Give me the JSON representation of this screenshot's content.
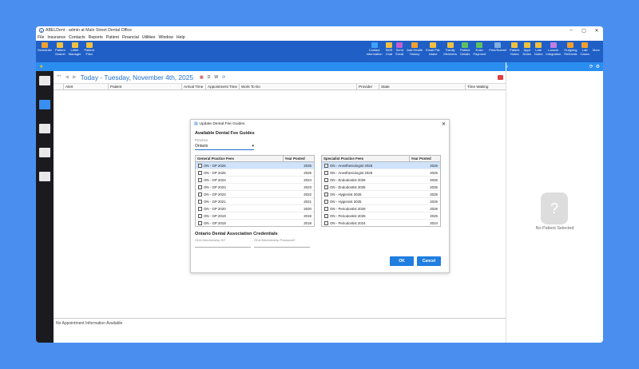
{
  "window": {
    "title": "ABELDent - admin at Main Street Dental Office"
  },
  "menu": [
    "File",
    "Insurance",
    "Contacts",
    "Reports",
    "Patient",
    "Financial",
    "Utilities",
    "Window",
    "Help"
  ],
  "toolbar_left": [
    {
      "label": "Scheduler",
      "icon": "scheduler-icon",
      "color": "#f0a030"
    },
    {
      "label": "Patient\nSearch",
      "icon": "patient-search-icon",
      "color": "#f0c040"
    },
    {
      "label": "Letter\nManager",
      "icon": "letter-manager-icon",
      "color": "#f0c040"
    },
    {
      "label": "Patient\nFiles",
      "icon": "patient-files-icon",
      "color": "#f0c040"
    }
  ],
  "toolbar_right": [
    {
      "label": "Contact\nInformation",
      "icon": "contact-info-icon",
      "color": "#3fa0ff"
    },
    {
      "label": "SMS\nChat",
      "icon": "sms-chat-icon",
      "color": "#f0c040"
    },
    {
      "label": "Send\nEmail",
      "icon": "send-email-icon",
      "color": "#c060d0"
    },
    {
      "label": "Add Health\nHistory",
      "icon": "health-history-icon",
      "color": "#f0a030"
    },
    {
      "label": "Email Pat.\nIntake",
      "icon": "email-intake-icon",
      "color": "#f0c040"
    },
    {
      "label": "Family\nMembers",
      "icon": "family-members-icon",
      "color": "#f0c040"
    },
    {
      "label": "Patient\nDetails",
      "icon": "patient-details-icon",
      "color": "#60c060"
    },
    {
      "label": "Enter\nPayment",
      "icon": "enter-payment-icon",
      "color": "#60c060"
    },
    {
      "label": "Print/Submit",
      "icon": "print-submit-icon",
      "color": "#80b0e0"
    },
    {
      "label": "Patient\nNotes",
      "icon": "patient-notes-icon",
      "color": "#f0c040"
    },
    {
      "label": "Appt\nNotes",
      "icon": "appt-notes-icon",
      "color": "#f0c040"
    },
    {
      "label": "Late\nNotes",
      "icon": "late-notes-icon",
      "color": "#f0c040"
    },
    {
      "label": "Launch\nIntegration",
      "icon": "launch-integration-icon",
      "color": "#c080e0"
    },
    {
      "label": "Outgoing\nReferrals",
      "icon": "outgoing-referrals-icon",
      "color": "#f0a030"
    },
    {
      "label": "Lab\nCases",
      "icon": "lab-cases-icon",
      "color": "#f0a030"
    },
    {
      "label": "More",
      "icon": "more-icon",
      "color": "#1f5fc6"
    }
  ],
  "schedule": {
    "today": "Today",
    "date": "Tuesday, November 4th, 2025",
    "d_label": "D",
    "w_label": "W",
    "columns": [
      "Alert",
      "Patient",
      "Arrival Time",
      "Appointment Time",
      "Work To Do",
      "Provider",
      "State",
      "Time Waiting"
    ],
    "footer": "No Appointment Information Available"
  },
  "right_panel": {
    "no_patient": "No Patient Selected"
  },
  "dialog": {
    "title": "Update Dental Fee Guides",
    "heading": "Available Dental Fee Guides",
    "province_label": "Province",
    "province_value": "Ontario",
    "general": {
      "col_name": "General Practice Fees",
      "col_year": "Year Posted",
      "rows": [
        {
          "name": "ON - GP 2026",
          "year": "2026",
          "selected": true
        },
        {
          "name": "ON - GP 2025",
          "year": "2025",
          "selected": false
        },
        {
          "name": "ON - GP 2024",
          "year": "2024",
          "selected": false
        },
        {
          "name": "ON - GP 2023",
          "year": "2023",
          "selected": false
        },
        {
          "name": "ON - GP 2022",
          "year": "2022",
          "selected": false
        },
        {
          "name": "ON - GP 2021",
          "year": "2021",
          "selected": false
        },
        {
          "name": "ON - GP 2020",
          "year": "2020",
          "selected": false
        },
        {
          "name": "ON - GP 2019",
          "year": "2019",
          "selected": false
        },
        {
          "name": "ON - GP 2018",
          "year": "2018",
          "selected": false
        }
      ]
    },
    "specialist": {
      "col_name": "Specialist Practice Fees",
      "col_year": "Year Posted",
      "rows": [
        {
          "name": "ON - Anesthesiologist 2026",
          "year": "2026",
          "selected": true
        },
        {
          "name": "ON - Anesthesiologist 2025",
          "year": "2025",
          "selected": false
        },
        {
          "name": "ON - Endodontist 2026",
          "year": "2026",
          "selected": false
        },
        {
          "name": "ON - Endodontist 2025",
          "year": "2025",
          "selected": false
        },
        {
          "name": "ON - Hygienist 2026",
          "year": "2026",
          "selected": false
        },
        {
          "name": "ON - Hygienist 2025",
          "year": "2025",
          "selected": false
        },
        {
          "name": "ON - Periodontist 2026",
          "year": "2026",
          "selected": false
        },
        {
          "name": "ON - Periodontist 2025",
          "year": "2025",
          "selected": false
        },
        {
          "name": "ON - Periodontist 2024",
          "year": "2024",
          "selected": false
        }
      ]
    },
    "creds_heading": "Ontario Dental Association Credentials",
    "membership_id": "ODA Membership ID*",
    "membership_pw": "ODA Membership Password*",
    "ok": "OK",
    "cancel": "Cancel"
  }
}
